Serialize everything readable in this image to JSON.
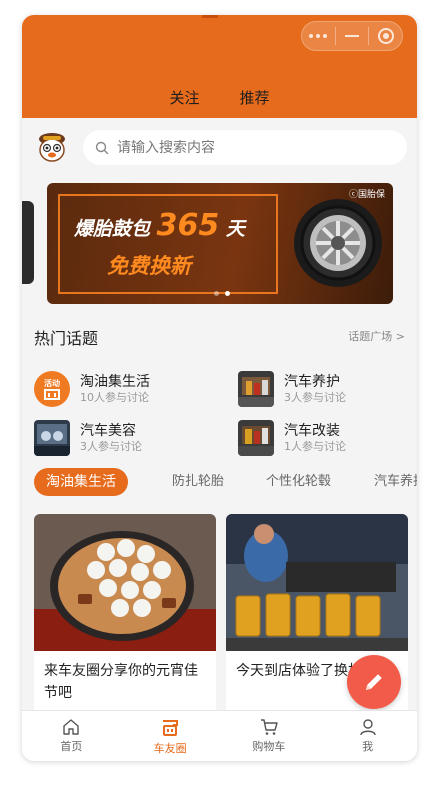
{
  "header": {
    "tabs": [
      {
        "label": "关注"
      },
      {
        "label": "推荐"
      }
    ],
    "colors": {
      "accent": "#e76b1c",
      "fab": "#f25a4a"
    }
  },
  "search": {
    "placeholder": "请输入搜索内容"
  },
  "banner": {
    "brand": "ⓒ国胎保",
    "line1_prefix": "爆胎鼓包",
    "line1_number": "365",
    "line1_suffix": "天",
    "line2": "免费换新"
  },
  "hot_topics": {
    "title": "热门话题",
    "more": "话题广场 >",
    "items": [
      {
        "name": "淘油集生活",
        "meta": "10人参与讨论",
        "thumb_label": "活动"
      },
      {
        "name": "汽车养护",
        "meta": "3人参与讨论"
      },
      {
        "name": "汽车美容",
        "meta": "3人参与讨论"
      },
      {
        "name": "汽车改装",
        "meta": "1人参与讨论"
      }
    ]
  },
  "chips": [
    {
      "label": "淘油集生活"
    },
    {
      "label": "防扎轮胎"
    },
    {
      "label": "个性化轮毂"
    },
    {
      "label": "汽车养护"
    }
  ],
  "cards": [
    {
      "title": "来车友圈分享你的元宵佳节吧"
    },
    {
      "title": "今天到店体验了换机油"
    }
  ],
  "tabbar": [
    {
      "label": "首页",
      "icon": "home-icon"
    },
    {
      "label": "车友圈",
      "icon": "car-circle-icon"
    },
    {
      "label": "购物车",
      "icon": "cart-icon"
    },
    {
      "label": "我",
      "icon": "user-icon"
    }
  ]
}
